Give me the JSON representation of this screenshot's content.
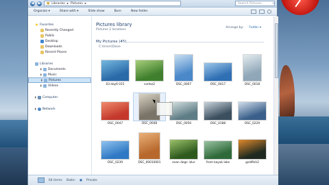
{
  "address": {
    "path": [
      "Libraries",
      "Pictures"
    ]
  },
  "search": {
    "placeholder": "Search Pictures"
  },
  "toolbar": {
    "organize": "Organize ▾",
    "share_with": "Share with ▾",
    "slide_show": "Slide show",
    "burn": "Burn",
    "new_folder": "New folder"
  },
  "sidebar": {
    "favorites": {
      "label": "Favorites",
      "items": [
        "Recently Changed",
        "Public",
        "Desktop",
        "Downloads",
        "Recent Places"
      ]
    },
    "libraries": {
      "label": "Libraries",
      "items": [
        "Documents",
        "Music",
        "Pictures",
        "Videos"
      ]
    },
    "computer": "Computer",
    "network": "Network"
  },
  "library": {
    "title": "Pictures library",
    "subtitle": "Pictures    2 locations",
    "arrange_label": "Arrange by:",
    "arrange_value": "Folder ▾"
  },
  "group": {
    "title": "My Pictures (45)",
    "location": "C:\\Users\\Dave"
  },
  "photos": [
    {
      "caption": "03 day6 015",
      "colors": [
        "#2a6aa8",
        "#76b8e0"
      ],
      "w": 42,
      "h": 32
    },
    {
      "caption": "cortez2",
      "colors": [
        "#3f7f2e",
        "#a8cf7a"
      ],
      "w": 42,
      "h": 32
    },
    {
      "caption": "DSC_0007",
      "colors": [
        "#4a88c9",
        "#c8dff2"
      ],
      "w": 28,
      "h": 40
    },
    {
      "caption": "DSC_0017",
      "colors": [
        "#2f6fb4",
        "#9cc7ea"
      ],
      "w": 42,
      "h": 28
    },
    {
      "caption": "DSC_0018",
      "colors": [
        "#8fa7b8",
        "#e4ecef"
      ],
      "w": 28,
      "h": 40
    },
    {
      "caption": "DSC_0047",
      "colors": [
        "#c4392c",
        "#f08a6e"
      ],
      "w": 42,
      "h": 28
    },
    {
      "caption": "DSC_0048",
      "colors": [
        "#7a7468",
        "#d9d3c4"
      ],
      "w": 32,
      "h": 40
    },
    {
      "caption": "DSC_0050",
      "colors": [
        "#5f7d86",
        "#d5e1e0"
      ],
      "w": 42,
      "h": 28
    },
    {
      "caption": "DSC_0188",
      "colors": [
        "#3c4f5f",
        "#c9d3da"
      ],
      "w": 42,
      "h": 28
    },
    {
      "caption": "DSC_0229",
      "colors": [
        "#3a5f8a",
        "#cfdcea"
      ],
      "w": 42,
      "h": 28
    },
    {
      "caption": "DSC_0239",
      "colors": [
        "#2f79c4",
        "#8fc2ee"
      ],
      "w": 42,
      "h": 28
    },
    {
      "caption": "DSC_00010001",
      "colors": [
        "#b8682c",
        "#e9b17a"
      ],
      "w": 32,
      "h": 40
    },
    {
      "caption": "evan dogs- blur",
      "colors": [
        "#2e5a1e",
        "#9cc26a"
      ],
      "w": 42,
      "h": 30
    },
    {
      "caption": "from kayak lake",
      "colors": [
        "#2f6a3a",
        "#9ac3a2"
      ],
      "w": 42,
      "h": 28
    },
    {
      "caption": "goldfish2",
      "colors": [
        "#1e2a20",
        "#e0892c"
      ],
      "w": 42,
      "h": 30
    }
  ],
  "details": {
    "count": "64 items",
    "state_label": "State:",
    "state_value": "Private"
  }
}
